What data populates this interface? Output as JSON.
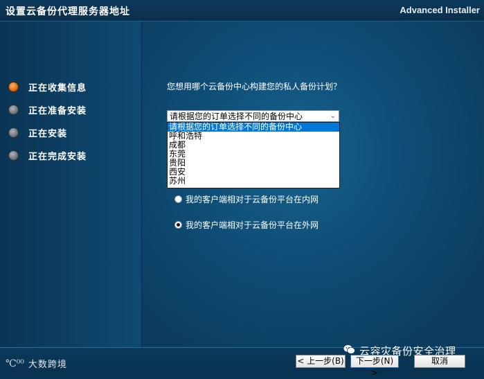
{
  "window": {
    "title": "设置云备份代理服务器地址",
    "brand": "Advanced Installer"
  },
  "steps": [
    {
      "label": "正在收集信息",
      "state": "active"
    },
    {
      "label": "正在准备安装",
      "state": "pending"
    },
    {
      "label": "正在安装",
      "state": "pending"
    },
    {
      "label": "正在完成安装",
      "state": "pending"
    }
  ],
  "main": {
    "question": "您想用哪个云备份中心构建您的私人备份计划？",
    "combo": {
      "value": "请根据您的订单选择不同的备份中心",
      "arrow": "⌄",
      "options": [
        "请根据您的订单选择不同的备份中心",
        "呼和浩特",
        "成都",
        "东莞",
        "贵阳",
        "西安",
        "苏州"
      ],
      "highlighted_index": 0
    },
    "radios": [
      {
        "label": "我的客户端相对于云备份平台在内网",
        "checked": false
      },
      {
        "label": "我的客户端相对于云备份平台在外网",
        "checked": true
      }
    ]
  },
  "footer": {
    "logo_mark": "℃⁰⁰",
    "logo_text": "大数跨境",
    "watermark": "云容灾备份安全治理",
    "buttons": {
      "back": "< 上一步(B)",
      "next": "下一步(N) >",
      "cancel": "取消"
    }
  },
  "colors": {
    "accent_step": "#e0721c",
    "selection": "#0078d7",
    "background": "#0c4468"
  }
}
